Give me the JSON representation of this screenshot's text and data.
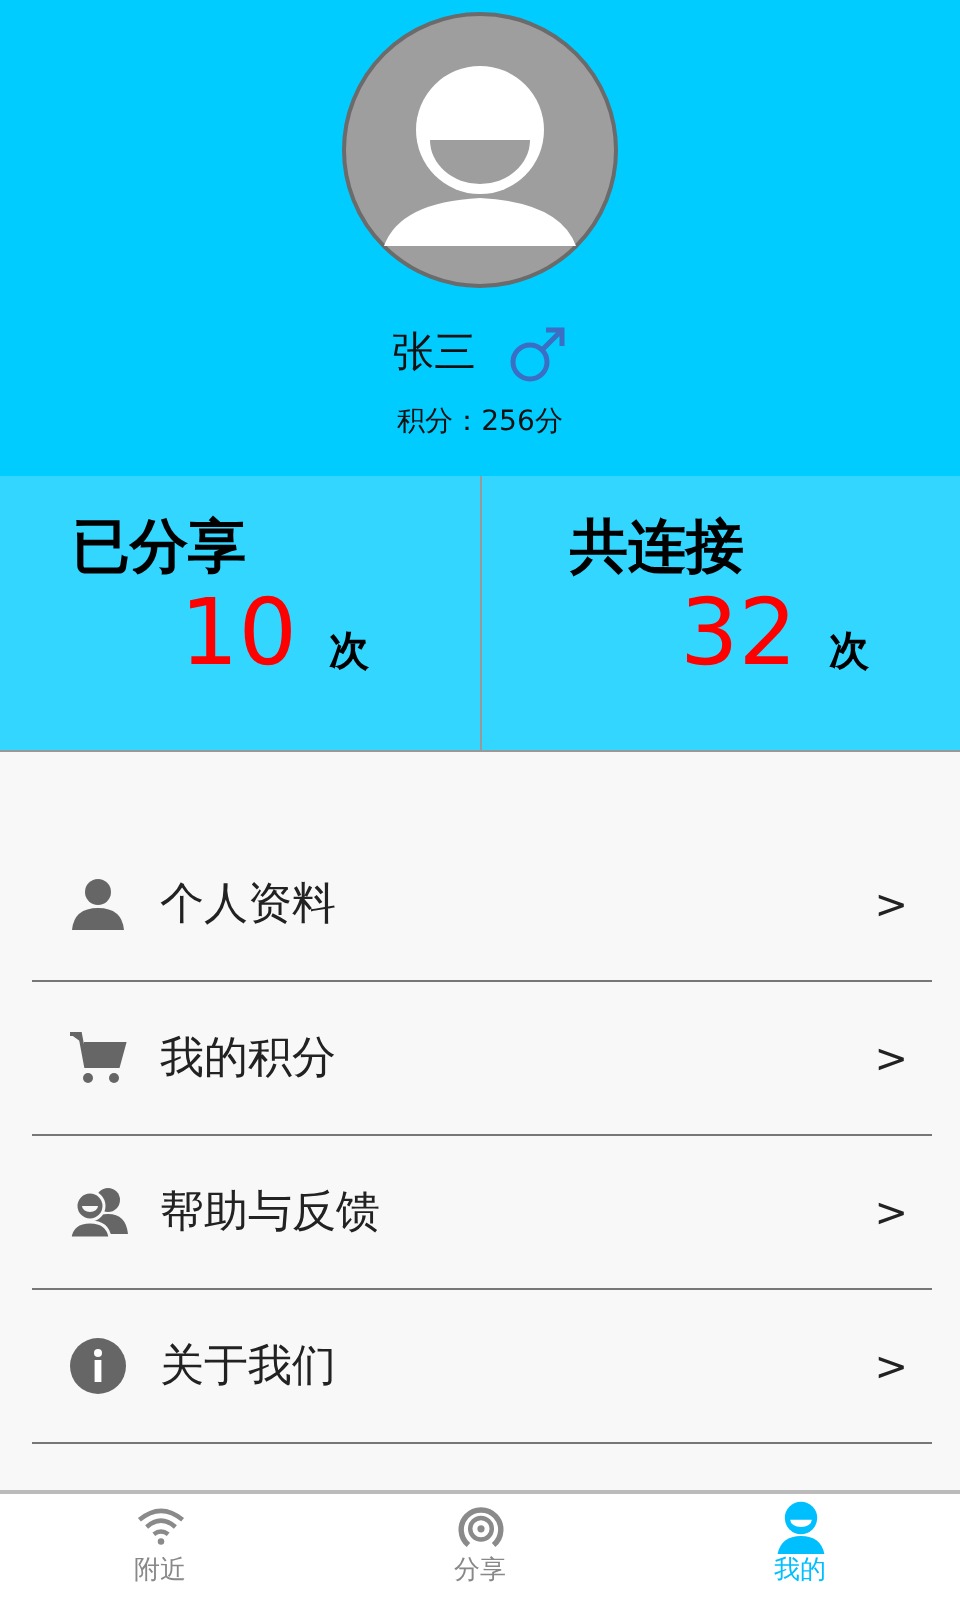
{
  "profile": {
    "name": "张三",
    "points": "积分：256分"
  },
  "stats": [
    {
      "label": "已分享",
      "value": "10",
      "unit": "次"
    },
    {
      "label": "共连接",
      "value": "32",
      "unit": "次"
    }
  ],
  "menu": [
    {
      "label": "个人资料",
      "arrow": ">"
    },
    {
      "label": "我的积分",
      "arrow": ">"
    },
    {
      "label": "帮助与反馈",
      "arrow": ">"
    },
    {
      "label": "关于我们",
      "arrow": ">"
    }
  ],
  "tabs": [
    {
      "label": "附近",
      "selected": false
    },
    {
      "label": "分享",
      "selected": false
    },
    {
      "label": "我的",
      "selected": true
    }
  ]
}
